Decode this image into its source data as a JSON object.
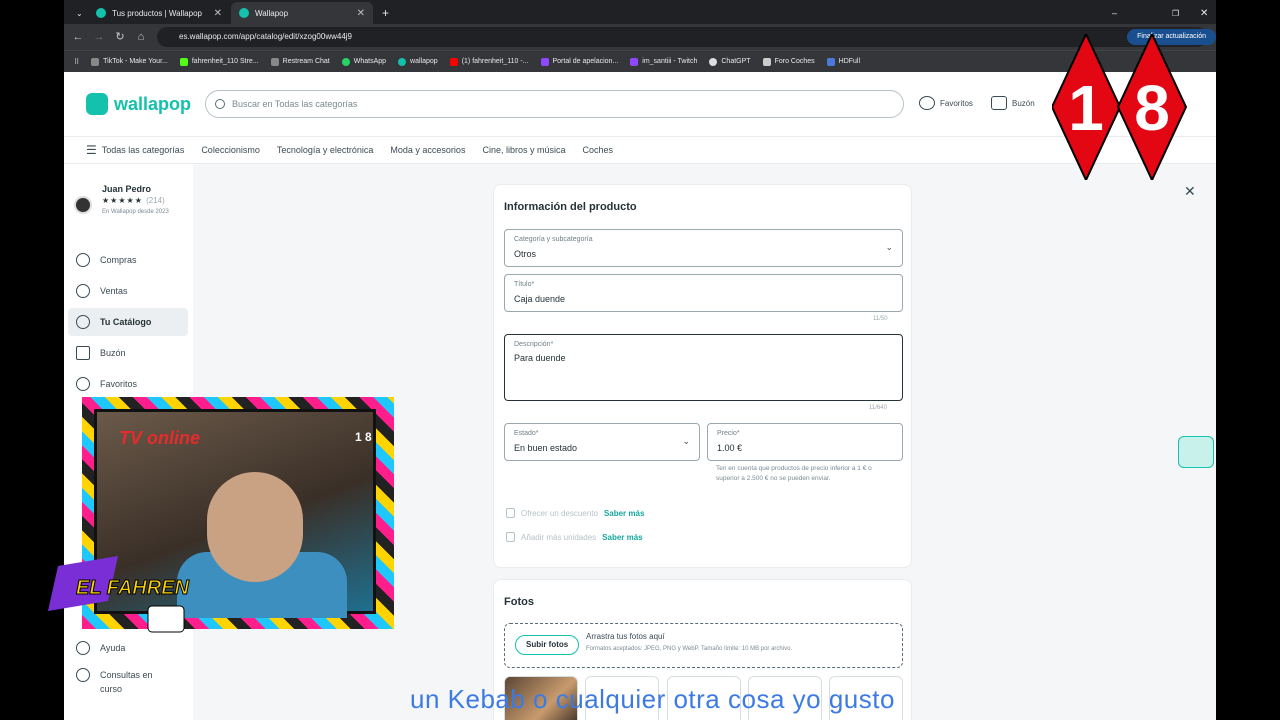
{
  "browser": {
    "tabs": [
      {
        "label": "Tus productos | Wallapop",
        "active": false
      },
      {
        "label": "Wallapop",
        "active": true
      }
    ],
    "url": "es.wallapop.com/app/catalog/edit/xzog00ww44j9",
    "update_label": "Finalizar actualización",
    "bookmarks": [
      "TikTok - Make Your...",
      "fahrenheit_110 Stre...",
      "Restream Chat",
      "WhatsApp",
      "wallapop",
      "(1) fahrenheit_110 -...",
      "Portal de apelacion...",
      "im_santiii - Twitch",
      "ChatGPT",
      "Foro Coches",
      "HDFull"
    ]
  },
  "header": {
    "logo": "wallapop",
    "search_placeholder": "Buscar en Todas las categorías",
    "favoritos": "Favoritos",
    "buzon": "Buzón"
  },
  "categories": [
    "Todas las categorías",
    "Coleccionismo",
    "Tecnología y electrónica",
    "Moda y accesorios",
    "Cine, libros y música",
    "Coches"
  ],
  "sidebar": {
    "user_name": "Juan Pedro",
    "stars": "★★★★★",
    "review_count": "(214)",
    "since": "En Wallapop desde 2023",
    "items": [
      "Compras",
      "Ventas",
      "Tu Catálogo",
      "Buzón",
      "Favoritos"
    ],
    "bottom_items": [
      "Ayuda",
      "Consultas en curso"
    ]
  },
  "product_info": {
    "heading": "Información del producto",
    "category_label": "Categoría y subcategoría",
    "category_value": "Otros",
    "title_label": "Título*",
    "title_value": "Caja duende",
    "title_counter": "11/50",
    "description_label": "Descripción*",
    "description_value": "Para duende",
    "description_counter": "11/640",
    "state_label": "Estado*",
    "state_value": "En buen estado",
    "price_label": "Precio*",
    "price_value": "1.00  €",
    "price_note": "Ten en cuenta que productos de precio inferior a 1 € o superior a 2.500 € no se pueden enviar.",
    "discount_label": "Ofrecer un descuento",
    "more_units_label": "Añadir más unidades",
    "saber_mas": "Saber más"
  },
  "photos": {
    "heading": "Fotos",
    "upload_button": "Subir fotos",
    "drop_text": "Arrastra tus fotos aquí",
    "formats": "Formatos aceptados: JPEG, PNG y WebP. Tamaño límite: 10 MB por archivo."
  },
  "overlay": {
    "badge": [
      "1",
      "8"
    ],
    "webcam_logo": "TV online",
    "webcam_badge": "1 8",
    "streamer_logo": "EL FAHREN",
    "subtitle": "un Kebab o cualquier otra cosa yo gusto"
  },
  "colors": {
    "accent": "#13c1ac",
    "badge_red": "#e30613"
  }
}
